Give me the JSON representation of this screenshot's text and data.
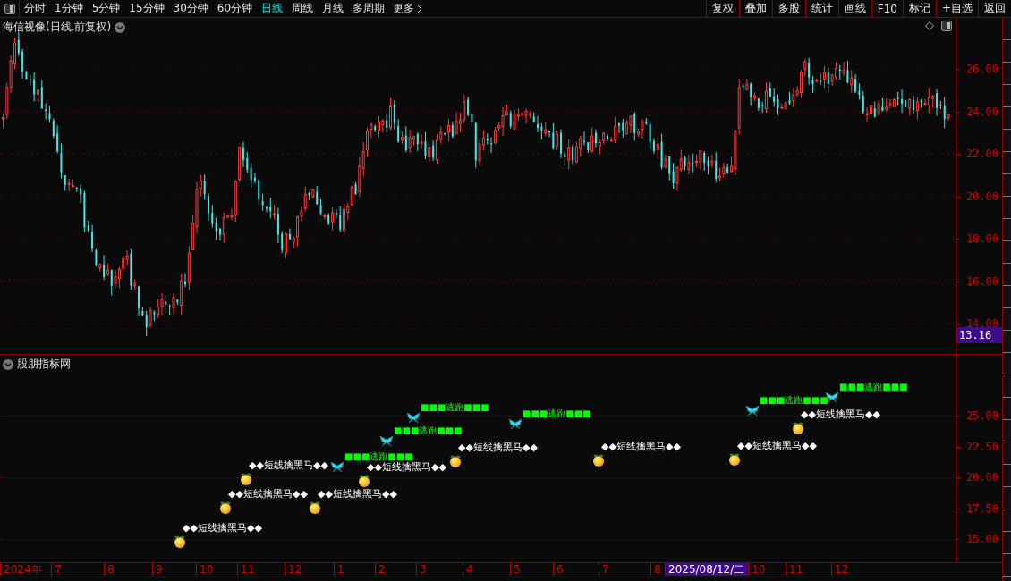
{
  "toolbar": {
    "periods": [
      {
        "label": "分时",
        "selected": false
      },
      {
        "label": "1分钟",
        "selected": false
      },
      {
        "label": "5分钟",
        "selected": false
      },
      {
        "label": "15分钟",
        "selected": false
      },
      {
        "label": "30分钟",
        "selected": false
      },
      {
        "label": "60分钟",
        "selected": false
      },
      {
        "label": "日线",
        "selected": true
      },
      {
        "label": "周线",
        "selected": false
      },
      {
        "label": "月线",
        "selected": false
      },
      {
        "label": "多周期",
        "selected": false
      }
    ],
    "more": "更多",
    "actions": [
      "复权",
      "叠加",
      "多股",
      "统计",
      "画线",
      "F10",
      "标记",
      "+自选",
      "返回"
    ]
  },
  "price_panel": {
    "title": "海信视像(日线.前复权)",
    "axis_labels": [
      "26.00",
      "24.00",
      "22.00",
      "20.00",
      "18.00",
      "16.00",
      "14.00"
    ],
    "last_price": "13.16"
  },
  "indicator_panel": {
    "title": "股朋指标网",
    "axis_labels": [
      "25.00",
      "22.50",
      "20.00",
      "17.50",
      "15.00"
    ],
    "signals": [
      {
        "kind": "sell",
        "label": "■■■逃跑■■■"
      },
      {
        "kind": "sell",
        "label": "■■■逃跑■■■"
      },
      {
        "kind": "sell",
        "label": "■■■逃跑■■■"
      },
      {
        "kind": "sell",
        "label": "■■■逃跑■■■"
      },
      {
        "kind": "buy",
        "label": "◆◆短线擒黑马◆◆"
      },
      {
        "kind": "sell",
        "label": "■■■逃跑■■■"
      },
      {
        "kind": "buy",
        "label": "◆◆短线擒黑马◆◆"
      },
      {
        "kind": "buy",
        "label": "◆◆短线擒黑马◆◆"
      },
      {
        "kind": "buy",
        "label": "◆◆短线擒黑马◆◆"
      },
      {
        "kind": "sell",
        "label": "■■■逃跑■■■"
      },
      {
        "kind": "buy",
        "label": "◆◆短线擒黑马◆◆"
      },
      {
        "kind": "buy",
        "label": "◆◆短线擒黑马◆◆"
      },
      {
        "kind": "buy",
        "label": "◆◆短线擒黑马◆◆"
      },
      {
        "kind": "buy",
        "label": "◆◆短线擒黑马◆◆"
      },
      {
        "kind": "buy",
        "label": "◆◆短线擒黑马◆◆"
      }
    ]
  },
  "date_axis": [
    {
      "label": "2024年",
      "selected": false
    },
    {
      "label": "7",
      "selected": false
    },
    {
      "label": "8",
      "selected": false
    },
    {
      "label": "9",
      "selected": false
    },
    {
      "label": "10",
      "selected": false
    },
    {
      "label": "11",
      "selected": false
    },
    {
      "label": "12",
      "selected": false
    },
    {
      "label": "1",
      "selected": false
    },
    {
      "label": "2",
      "selected": false
    },
    {
      "label": "3",
      "selected": false
    },
    {
      "label": "4",
      "selected": false
    },
    {
      "label": "5",
      "selected": false
    },
    {
      "label": "6",
      "selected": false
    },
    {
      "label": "7",
      "selected": false
    },
    {
      "label": "8",
      "selected": false
    },
    {
      "label": "2025/08/12/二",
      "selected": true
    },
    {
      "label": "10",
      "selected": false
    },
    {
      "label": "11",
      "selected": false
    },
    {
      "label": "12",
      "selected": false
    }
  ]
}
